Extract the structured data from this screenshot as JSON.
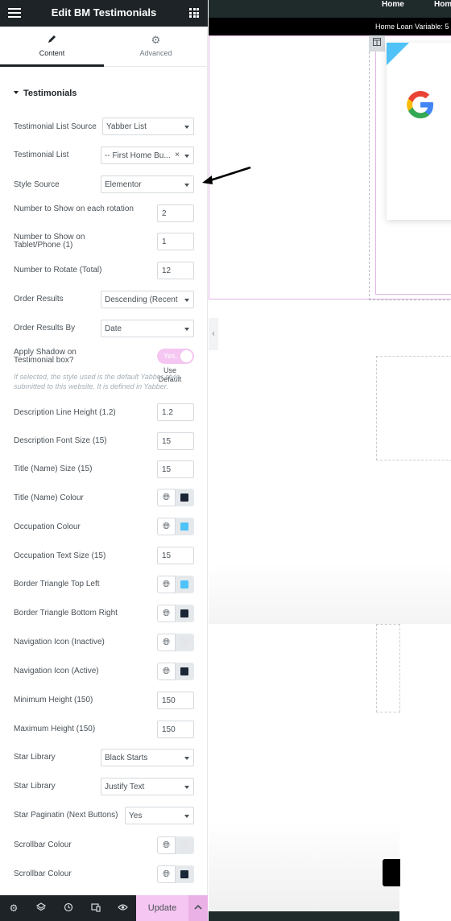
{
  "header": {
    "title": "Edit BM Testimonials",
    "menu_icon": "hamburger-icon",
    "apps_icon": "grid-icon"
  },
  "tabs": [
    {
      "label": "Content",
      "icon": "pencil-icon"
    },
    {
      "label": "Advanced",
      "icon": "gear-icon"
    }
  ],
  "section": {
    "title": "Testimonials"
  },
  "controls": {
    "list_source": {
      "label": "Testimonial List Source",
      "value": "Yabber List"
    },
    "list": {
      "label": "Testimonial List",
      "value": "-- First Home Bu...",
      "clear": "×"
    },
    "style_source": {
      "label": "Style Source",
      "value": "Elementor"
    },
    "show_each": {
      "label": "Number to Show on each rotation",
      "value": "2"
    },
    "show_tablet": {
      "label": "Number to Show on Tablet/Phone (1)",
      "value": "1"
    },
    "rotate_total": {
      "label": "Number to Rotate (Total)",
      "value": "12"
    },
    "order_results": {
      "label": "Order Results",
      "value": "Descending (Recent"
    },
    "order_by": {
      "label": "Order Results By",
      "value": "Date"
    },
    "shadow": {
      "label": "Apply Shadow on Testimonial box?",
      "toggle": "Yes,",
      "default_label": "Use Default",
      "description": "If selected, the style used is the default Yabber style submitted to this website. It is defined in Yabber."
    },
    "desc_line_height": {
      "label": "Description Line Height (1.2)",
      "value": "1.2"
    },
    "desc_font_size": {
      "label": "Description Font Size (15)",
      "value": "15"
    },
    "title_size": {
      "label": "Title (Name) Size (15)",
      "value": "15"
    },
    "title_colour": {
      "label": "Title (Name) Colour",
      "color": "#1a2535"
    },
    "occupation_colour": {
      "label": "Occupation Colour",
      "color": "#4fc3f7"
    },
    "occupation_size": {
      "label": "Occupation Text Size (15)",
      "value": "15"
    },
    "tri_top_left": {
      "label": "Border Triangle Top Left",
      "color": "#4fc3f7"
    },
    "tri_bottom_right": {
      "label": "Border Triangle Bottom Right",
      "color": "#1a2535"
    },
    "nav_inactive": {
      "label": "Navigation Icon (Inactive)",
      "color": "#e3e5e8"
    },
    "nav_active": {
      "label": "Navigation Icon (Active)",
      "color": "#1a2535"
    },
    "min_height": {
      "label": "Minimum Height (150)",
      "value": "150"
    },
    "max_height": {
      "label": "Maximum Height (150)",
      "value": "150"
    },
    "star_library_1": {
      "label": "Star Library",
      "value": "Black Starts"
    },
    "star_library_2": {
      "label": "Star Library",
      "value": "Justify Text"
    },
    "star_pagination": {
      "label": "Star Paginatin (Next Buttons)",
      "value": "Yes"
    },
    "scrollbar_colour_1": {
      "label": "Scrollbar Colour",
      "color": "#e3e5e8"
    },
    "scrollbar_colour_2": {
      "label": "Scrollbar Colour",
      "color": "#1a2535"
    }
  },
  "footer": {
    "icons": [
      "settings-icon",
      "layers-icon",
      "history-icon",
      "responsive-icon",
      "eye-icon"
    ],
    "update_label": "Update",
    "more_icon": "chevron-up-icon"
  },
  "preview": {
    "nav": [
      "Home",
      "Hom"
    ],
    "ticker": "Home Loan Variable: 5",
    "column_handle_icon": "column-icon",
    "card_logo": "google-logo"
  },
  "colors": {
    "accent_pink": "#f5c6f1",
    "dark": "#1d2327",
    "triangle_blue": "#4fc3f7"
  }
}
